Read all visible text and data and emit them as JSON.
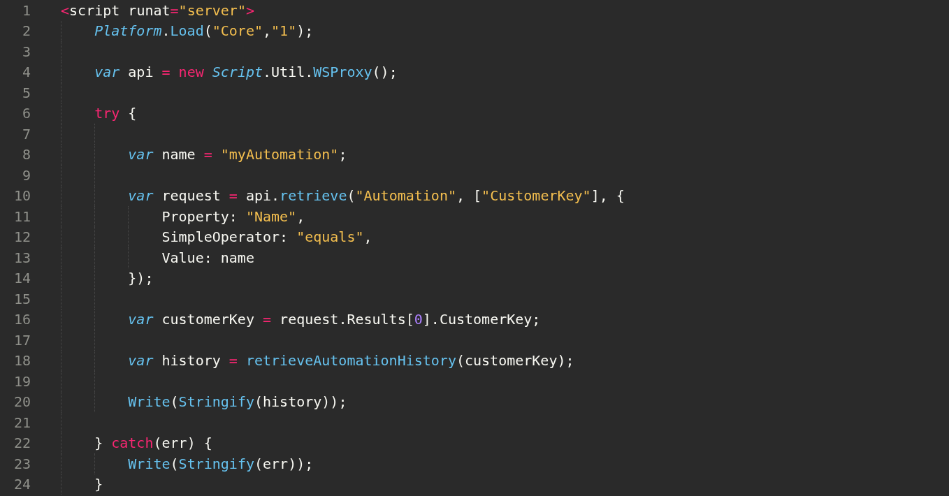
{
  "editor": {
    "lines": [
      {
        "number": "1",
        "tokens": [
          {
            "kind": "keyword",
            "text": "<"
          },
          {
            "kind": "plain",
            "text": "script runat"
          },
          {
            "kind": "keyword",
            "text": "="
          },
          {
            "kind": "string",
            "text": "\"server\""
          },
          {
            "kind": "keyword",
            "text": ">"
          }
        ]
      },
      {
        "number": "2",
        "tokens": [
          {
            "kind": "class",
            "text": "    Platform"
          },
          {
            "kind": "plain",
            "text": "."
          },
          {
            "kind": "func",
            "text": "Load"
          },
          {
            "kind": "plain",
            "text": "("
          },
          {
            "kind": "string",
            "text": "\"Core\""
          },
          {
            "kind": "plain",
            "text": ","
          },
          {
            "kind": "string",
            "text": "\"1\""
          },
          {
            "kind": "plain",
            "text": ");"
          }
        ]
      },
      {
        "number": "3"
      },
      {
        "number": "4",
        "tokens": [
          {
            "kind": "class",
            "text": "    var"
          },
          {
            "kind": "plain",
            "text": " api "
          },
          {
            "kind": "keyword",
            "text": "="
          },
          {
            "kind": "keyword",
            "text": " new"
          },
          {
            "kind": "class",
            "text": " Script"
          },
          {
            "kind": "plain",
            "text": ".Util."
          },
          {
            "kind": "func",
            "text": "WSProxy"
          },
          {
            "kind": "plain",
            "text": "();"
          }
        ]
      },
      {
        "number": "5"
      },
      {
        "number": "6",
        "tokens": [
          {
            "kind": "keyword",
            "text": "    try"
          },
          {
            "kind": "plain",
            "text": " {"
          }
        ]
      },
      {
        "number": "7"
      },
      {
        "number": "8",
        "tokens": [
          {
            "kind": "class",
            "text": "        var"
          },
          {
            "kind": "plain",
            "text": " name "
          },
          {
            "kind": "keyword",
            "text": "="
          },
          {
            "kind": "string",
            "text": " \"myAutomation\""
          },
          {
            "kind": "plain",
            "text": ";"
          }
        ]
      },
      {
        "number": "9"
      },
      {
        "number": "10",
        "tokens": [
          {
            "kind": "class",
            "text": "        var"
          },
          {
            "kind": "plain",
            "text": " request "
          },
          {
            "kind": "keyword",
            "text": "="
          },
          {
            "kind": "plain",
            "text": " api."
          },
          {
            "kind": "func",
            "text": "retrieve"
          },
          {
            "kind": "plain",
            "text": "("
          },
          {
            "kind": "string",
            "text": "\"Automation\""
          },
          {
            "kind": "plain",
            "text": ", ["
          },
          {
            "kind": "string",
            "text": "\"CustomerKey\""
          },
          {
            "kind": "plain",
            "text": "], {"
          }
        ]
      },
      {
        "number": "11",
        "tokens": [
          {
            "kind": "plain",
            "text": "            Property: "
          },
          {
            "kind": "string",
            "text": "\"Name\""
          },
          {
            "kind": "plain",
            "text": ","
          }
        ]
      },
      {
        "number": "12",
        "tokens": [
          {
            "kind": "plain",
            "text": "            SimpleOperator: "
          },
          {
            "kind": "string",
            "text": "\"equals\""
          },
          {
            "kind": "plain",
            "text": ","
          }
        ]
      },
      {
        "number": "13",
        "tokens": [
          {
            "kind": "plain",
            "text": "            Value: name"
          }
        ]
      },
      {
        "number": "14",
        "tokens": [
          {
            "kind": "plain",
            "text": "        });"
          }
        ]
      },
      {
        "number": "15"
      },
      {
        "number": "16",
        "tokens": [
          {
            "kind": "class",
            "text": "        var"
          },
          {
            "kind": "plain",
            "text": " customerKey "
          },
          {
            "kind": "keyword",
            "text": "="
          },
          {
            "kind": "plain",
            "text": " request.Results["
          },
          {
            "kind": "number",
            "text": "0"
          },
          {
            "kind": "plain",
            "text": "].CustomerKey;"
          }
        ]
      },
      {
        "number": "17"
      },
      {
        "number": "18",
        "tokens": [
          {
            "kind": "class",
            "text": "        var"
          },
          {
            "kind": "plain",
            "text": " history "
          },
          {
            "kind": "keyword",
            "text": "="
          },
          {
            "kind": "func",
            "text": " retrieveAutomationHistory"
          },
          {
            "kind": "plain",
            "text": "(customerKey);"
          }
        ]
      },
      {
        "number": "19"
      },
      {
        "number": "20",
        "tokens": [
          {
            "kind": "func",
            "text": "        Write"
          },
          {
            "kind": "plain",
            "text": "("
          },
          {
            "kind": "func",
            "text": "Stringify"
          },
          {
            "kind": "plain",
            "text": "(history));"
          }
        ]
      },
      {
        "number": "21"
      },
      {
        "number": "22",
        "tokens": [
          {
            "kind": "plain",
            "text": "    } "
          },
          {
            "kind": "keyword",
            "text": "catch"
          },
          {
            "kind": "plain",
            "text": "(err) {"
          }
        ]
      },
      {
        "number": "23",
        "tokens": [
          {
            "kind": "func",
            "text": "        Write"
          },
          {
            "kind": "plain",
            "text": "("
          },
          {
            "kind": "func",
            "text": "Stringify"
          },
          {
            "kind": "plain",
            "text": "(err));"
          }
        ]
      },
      {
        "number": "24",
        "tokens": [
          {
            "kind": "plain",
            "text": "    }"
          }
        ]
      }
    ]
  }
}
